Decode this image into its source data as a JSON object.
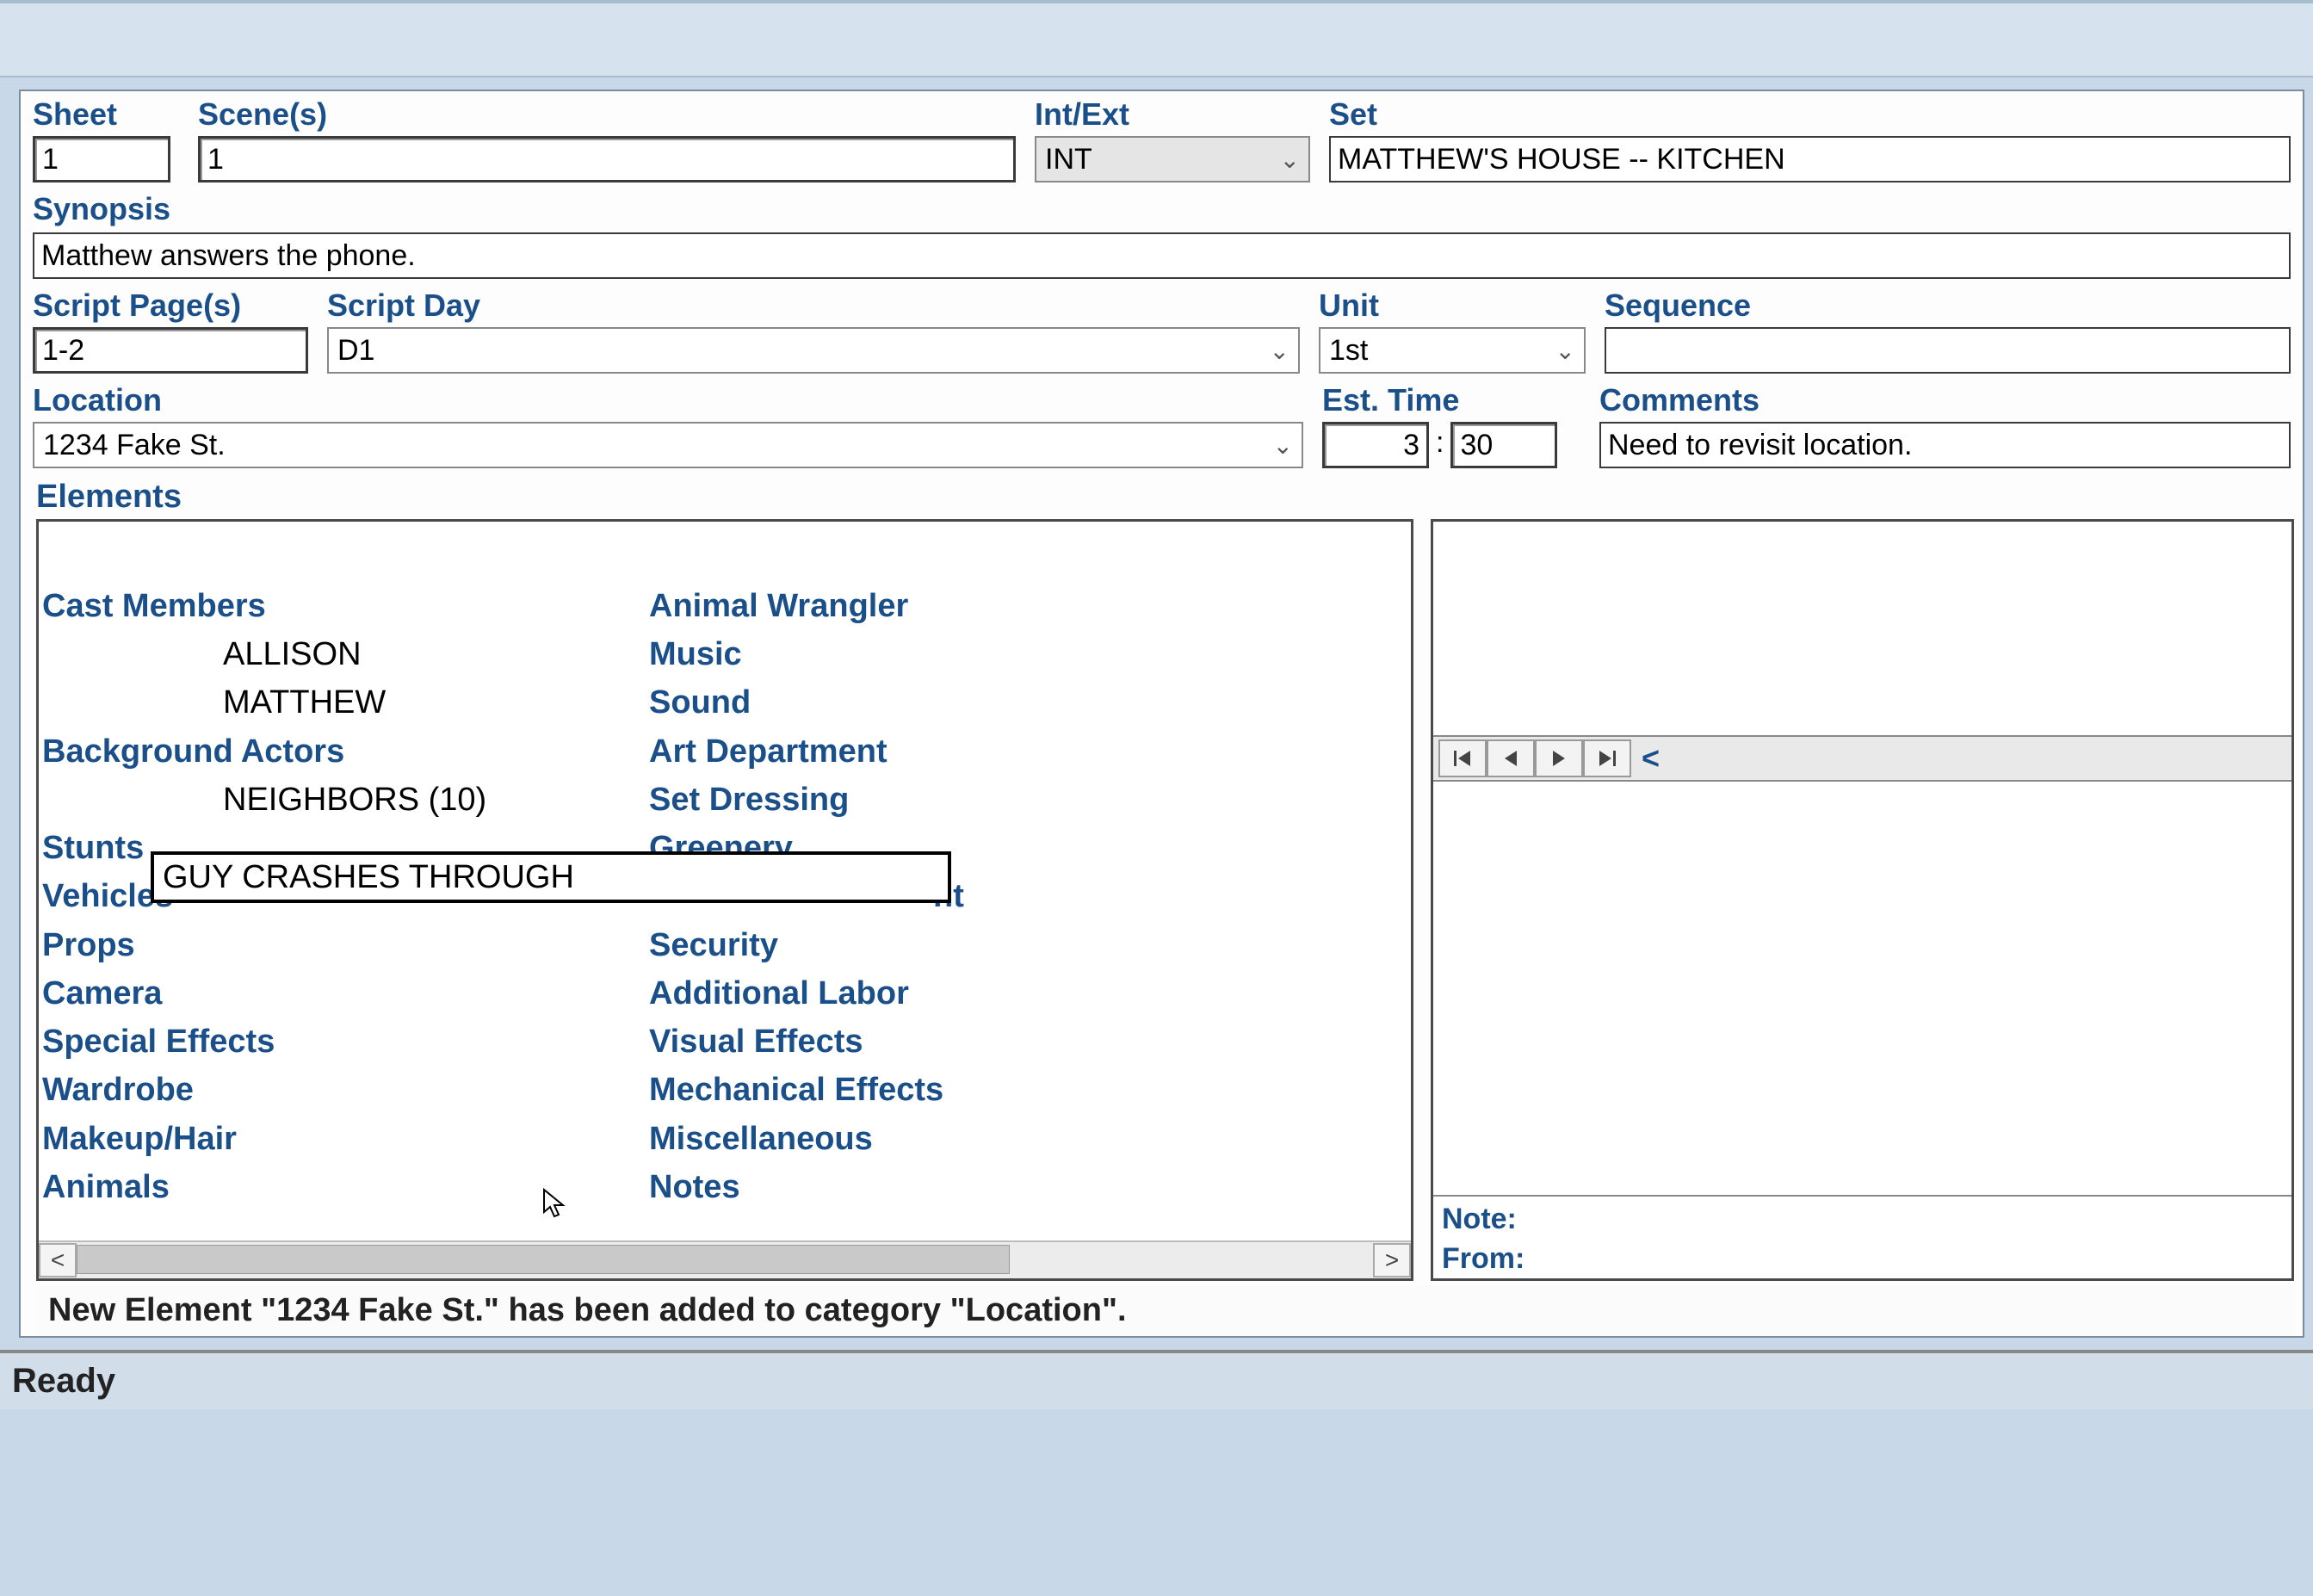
{
  "fields": {
    "sheet": {
      "label": "Sheet",
      "value": "1"
    },
    "scenes": {
      "label": "Scene(s)",
      "value": "1"
    },
    "intext": {
      "label": "Int/Ext",
      "value": "INT"
    },
    "set": {
      "label": "Set",
      "value": "MATTHEW'S HOUSE -- KITCHEN"
    },
    "synopsis": {
      "label": "Synopsis",
      "value": "Matthew answers the phone."
    },
    "script_pages": {
      "label": "Script Page(s)",
      "value": "1-2"
    },
    "script_day": {
      "label": "Script Day",
      "value": "D1"
    },
    "unit": {
      "label": "Unit",
      "value": "1st"
    },
    "sequence": {
      "label": "Sequence",
      "value": ""
    },
    "location": {
      "label": "Location",
      "value": "1234 Fake St."
    },
    "est_time": {
      "label": "Est. Time",
      "h": "3",
      "m": "30",
      "sep": ":"
    },
    "comments": {
      "label": "Comments",
      "value": "Need to revisit location."
    }
  },
  "elements": {
    "label": "Elements",
    "inline_edit": "GUY CRASHES THROUGH",
    "col1": [
      {
        "type": "cat",
        "text": "Cast Members"
      },
      {
        "type": "item",
        "text": "ALLISON"
      },
      {
        "type": "item",
        "text": "MATTHEW"
      },
      {
        "type": "cat",
        "text": "Background Actors"
      },
      {
        "type": "item",
        "text": "NEIGHBORS (10)"
      },
      {
        "type": "cat",
        "text": "Stunts"
      },
      {
        "type": "cat",
        "text": "Vehicles"
      },
      {
        "type": "cat",
        "text": "Props"
      },
      {
        "type": "cat",
        "text": "Camera"
      },
      {
        "type": "cat",
        "text": "Special Effects"
      },
      {
        "type": "cat",
        "text": "Wardrobe"
      },
      {
        "type": "cat",
        "text": "Makeup/Hair"
      },
      {
        "type": "cat",
        "text": "Animals"
      }
    ],
    "col2": [
      {
        "type": "cat",
        "text": "Animal Wrangler"
      },
      {
        "type": "cat",
        "text": "Music"
      },
      {
        "type": "cat",
        "text": "Sound"
      },
      {
        "type": "cat",
        "text": "Art Department"
      },
      {
        "type": "cat",
        "text": "Set Dressing"
      },
      {
        "type": "cat",
        "text": "Greenery"
      },
      {
        "type": "cat_tail",
        "text": "nt"
      },
      {
        "type": "cat",
        "text": "Security"
      },
      {
        "type": "cat",
        "text": "Additional Labor"
      },
      {
        "type": "cat",
        "text": "Visual Effects"
      },
      {
        "type": "cat",
        "text": "Mechanical Effects"
      },
      {
        "type": "cat",
        "text": "Miscellaneous"
      },
      {
        "type": "cat",
        "text": "Notes"
      }
    ],
    "note_label": "Note:",
    "from_label": "From:",
    "nav_extra": "<"
  },
  "info_strip": "New Element \"1234 Fake St.\" has been added to category \"Location\".",
  "status": "Ready",
  "glyphs": {
    "chev": "⌄",
    "first": "⏮",
    "prev": "◀",
    "next": "▶",
    "last": "⏭",
    "left": "<",
    "right": ">"
  }
}
